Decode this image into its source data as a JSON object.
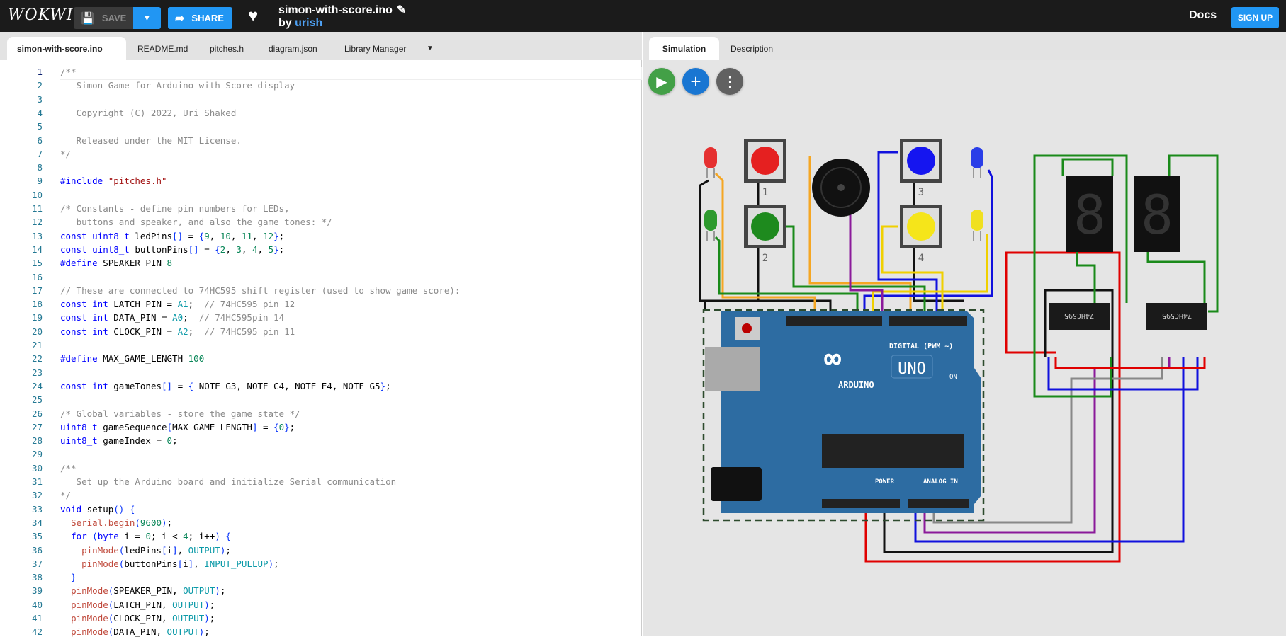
{
  "header": {
    "logo": "WOKWI",
    "save_label": "SAVE",
    "share_label": "SHARE",
    "project_title": "simon-with-score.ino",
    "by_label": "by",
    "author": "urish",
    "docs_label": "Docs",
    "signup_label": "SIGN UP"
  },
  "editor_tabs": [
    {
      "label": "simon-with-score.ino",
      "active": true
    },
    {
      "label": "README.md"
    },
    {
      "label": "pitches.h"
    },
    {
      "label": "diagram.json"
    },
    {
      "label": "Library Manager"
    }
  ],
  "sim_tabs": [
    {
      "label": "Simulation",
      "active": true
    },
    {
      "label": "Description"
    }
  ],
  "colors": {
    "accent": "#2196f3",
    "run": "#43a047",
    "add": "#1976d2",
    "more": "#616161",
    "board": "#2d6ca2"
  },
  "circuit": {
    "button_labels": [
      "1",
      "2",
      "3",
      "4"
    ],
    "board_brand": "ARDUINO",
    "board_model": "UNO",
    "digital_label": "DIGITAL (PWM ~)",
    "power_label": "POWER",
    "analog_label": "ANALOG IN",
    "on_label": "ON",
    "chip_label": "74HC595"
  },
  "code": [
    [
      [
        "c",
        "/**"
      ]
    ],
    [
      [
        "c",
        "   Simon Game for Arduino with Score display"
      ]
    ],
    [
      [
        "c",
        ""
      ]
    ],
    [
      [
        "c",
        "   Copyright (C) 2022, Uri Shaked"
      ]
    ],
    [
      [
        "c",
        ""
      ]
    ],
    [
      [
        "c",
        "   Released under the MIT License."
      ]
    ],
    [
      [
        "c",
        "*/"
      ]
    ],
    [],
    [
      [
        "k",
        "#include "
      ],
      [
        "s",
        "\"pitches.h\""
      ]
    ],
    [],
    [
      [
        "c",
        "/* Constants - define pin numbers for LEDs,"
      ]
    ],
    [
      [
        "c",
        "   buttons and speaker, and also the game tones: */"
      ]
    ],
    [
      [
        "k",
        "const uint8_t "
      ],
      [
        "p",
        "ledPins"
      ],
      [
        "b",
        "[]"
      ],
      [
        "p",
        " = "
      ],
      [
        "b",
        "{"
      ],
      [
        "n",
        "9"
      ],
      [
        "p",
        ", "
      ],
      [
        "n",
        "10"
      ],
      [
        "p",
        ", "
      ],
      [
        "n",
        "11"
      ],
      [
        "p",
        ", "
      ],
      [
        "n",
        "12"
      ],
      [
        "b",
        "}"
      ],
      [
        "p",
        ";"
      ]
    ],
    [
      [
        "k",
        "const uint8_t "
      ],
      [
        "p",
        "buttonPins"
      ],
      [
        "b",
        "[]"
      ],
      [
        "p",
        " = "
      ],
      [
        "b",
        "{"
      ],
      [
        "n",
        "2"
      ],
      [
        "p",
        ", "
      ],
      [
        "n",
        "3"
      ],
      [
        "p",
        ", "
      ],
      [
        "n",
        "4"
      ],
      [
        "p",
        ", "
      ],
      [
        "n",
        "5"
      ],
      [
        "b",
        "}"
      ],
      [
        "p",
        ";"
      ]
    ],
    [
      [
        "k",
        "#define "
      ],
      [
        "p",
        "SPEAKER_PIN "
      ],
      [
        "n",
        "8"
      ]
    ],
    [],
    [
      [
        "c",
        "// These are connected to 74HC595 shift register (used to show game score):"
      ]
    ],
    [
      [
        "k",
        "const int "
      ],
      [
        "p",
        "LATCH_PIN = "
      ],
      [
        "t",
        "A1"
      ],
      [
        "p",
        ";  "
      ],
      [
        "c",
        "// 74HC595 pin 12"
      ]
    ],
    [
      [
        "k",
        "const int "
      ],
      [
        "p",
        "DATA_PIN = "
      ],
      [
        "t",
        "A0"
      ],
      [
        "p",
        ";  "
      ],
      [
        "c",
        "// 74HC595pin 14"
      ]
    ],
    [
      [
        "k",
        "const int "
      ],
      [
        "p",
        "CLOCK_PIN = "
      ],
      [
        "t",
        "A2"
      ],
      [
        "p",
        ";  "
      ],
      [
        "c",
        "// 74HC595 pin 11"
      ]
    ],
    [],
    [
      [
        "k",
        "#define "
      ],
      [
        "p",
        "MAX_GAME_LENGTH "
      ],
      [
        "n",
        "100"
      ]
    ],
    [],
    [
      [
        "k",
        "const int "
      ],
      [
        "p",
        "gameTones"
      ],
      [
        "b",
        "[]"
      ],
      [
        "p",
        " = "
      ],
      [
        "b",
        "{"
      ],
      [
        "p",
        " NOTE_G3, NOTE_C4, NOTE_E4, NOTE_G5"
      ],
      [
        "b",
        "}"
      ],
      [
        "p",
        ";"
      ]
    ],
    [],
    [
      [
        "c",
        "/* Global variables - store the game state */"
      ]
    ],
    [
      [
        "k",
        "uint8_t "
      ],
      [
        "p",
        "gameSequence"
      ],
      [
        "b",
        "["
      ],
      [
        "p",
        "MAX_GAME_LENGTH"
      ],
      [
        "b",
        "]"
      ],
      [
        "p",
        " = "
      ],
      [
        "b",
        "{"
      ],
      [
        "n",
        "0"
      ],
      [
        "b",
        "}"
      ],
      [
        "p",
        ";"
      ]
    ],
    [
      [
        "k",
        "uint8_t "
      ],
      [
        "p",
        "gameIndex = "
      ],
      [
        "n",
        "0"
      ],
      [
        "p",
        ";"
      ]
    ],
    [],
    [
      [
        "c",
        "/**"
      ]
    ],
    [
      [
        "c",
        "   Set up the Arduino board and initialize Serial communication"
      ]
    ],
    [
      [
        "c",
        "*/"
      ]
    ],
    [
      [
        "k",
        "void "
      ],
      [
        "p",
        "setup"
      ],
      [
        "b",
        "()"
      ],
      [
        "p",
        " "
      ],
      [
        "b",
        "{"
      ]
    ],
    [
      [
        "p",
        "  "
      ],
      [
        "f",
        "Serial.begin"
      ],
      [
        "b",
        "("
      ],
      [
        "n",
        "9600"
      ],
      [
        "b",
        ")"
      ],
      [
        "p",
        ";"
      ]
    ],
    [
      [
        "p",
        "  "
      ],
      [
        "k",
        "for "
      ],
      [
        "b",
        "("
      ],
      [
        "k",
        "byte "
      ],
      [
        "p",
        "i = "
      ],
      [
        "n",
        "0"
      ],
      [
        "p",
        "; i < "
      ],
      [
        "n",
        "4"
      ],
      [
        "p",
        "; i++"
      ],
      [
        "b",
        ")"
      ],
      [
        "p",
        " "
      ],
      [
        "b",
        "{"
      ]
    ],
    [
      [
        "p",
        "    "
      ],
      [
        "f",
        "pinMode"
      ],
      [
        "b",
        "("
      ],
      [
        "p",
        "ledPins"
      ],
      [
        "b",
        "["
      ],
      [
        "p",
        "i"
      ],
      [
        "b",
        "]"
      ],
      [
        "p",
        ", "
      ],
      [
        "t",
        "OUTPUT"
      ],
      [
        "b",
        ")"
      ],
      [
        "p",
        ";"
      ]
    ],
    [
      [
        "p",
        "    "
      ],
      [
        "f",
        "pinMode"
      ],
      [
        "b",
        "("
      ],
      [
        "p",
        "buttonPins"
      ],
      [
        "b",
        "["
      ],
      [
        "p",
        "i"
      ],
      [
        "b",
        "]"
      ],
      [
        "p",
        ", "
      ],
      [
        "t",
        "INPUT_PULLUP"
      ],
      [
        "b",
        ")"
      ],
      [
        "p",
        ";"
      ]
    ],
    [
      [
        "p",
        "  "
      ],
      [
        "b",
        "}"
      ]
    ],
    [
      [
        "p",
        "  "
      ],
      [
        "f",
        "pinMode"
      ],
      [
        "b",
        "("
      ],
      [
        "p",
        "SPEAKER_PIN, "
      ],
      [
        "t",
        "OUTPUT"
      ],
      [
        "b",
        ")"
      ],
      [
        "p",
        ";"
      ]
    ],
    [
      [
        "p",
        "  "
      ],
      [
        "f",
        "pinMode"
      ],
      [
        "b",
        "("
      ],
      [
        "p",
        "LATCH_PIN, "
      ],
      [
        "t",
        "OUTPUT"
      ],
      [
        "b",
        ")"
      ],
      [
        "p",
        ";"
      ]
    ],
    [
      [
        "p",
        "  "
      ],
      [
        "f",
        "pinMode"
      ],
      [
        "b",
        "("
      ],
      [
        "p",
        "CLOCK_PIN, "
      ],
      [
        "t",
        "OUTPUT"
      ],
      [
        "b",
        ")"
      ],
      [
        "p",
        ";"
      ]
    ],
    [
      [
        "p",
        "  "
      ],
      [
        "f",
        "pinMode"
      ],
      [
        "b",
        "("
      ],
      [
        "p",
        "DATA_PIN, "
      ],
      [
        "t",
        "OUTPUT"
      ],
      [
        "b",
        ")"
      ],
      [
        "p",
        ";"
      ]
    ]
  ]
}
